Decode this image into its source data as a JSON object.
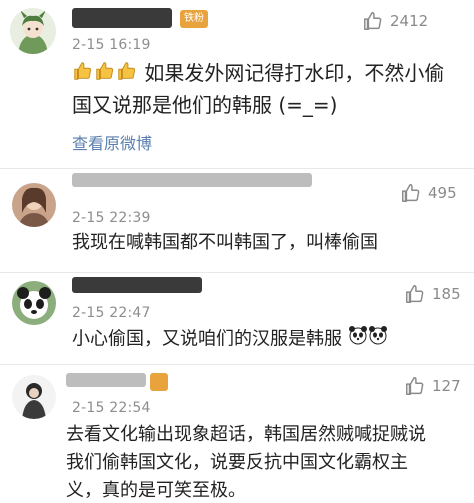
{
  "comments": [
    {
      "time": "2-15 16:19",
      "likes": "2412",
      "badge": "铁粉",
      "text_line1": "如果发外网记得打水印，不然小偷",
      "text_line2": "国又说那是他们的韩服 (=_=)",
      "view_original": "查看原微博",
      "thumb_emoji_icons": [
        "thumbs-up-icon",
        "thumbs-up-icon",
        "thumbs-up-icon"
      ]
    },
    {
      "time": "2-15 22:39",
      "likes": "495",
      "text": "我现在喊韩国都不叫韩国了，叫棒偷国"
    },
    {
      "time": "2-15 22:47",
      "likes": "185",
      "text": "小心偷国，又说咱们的汉服是韩服",
      "emoji_icons": [
        "panda-face-icon",
        "panda-face-icon"
      ]
    },
    {
      "time": "2-15 22:54",
      "likes": "127",
      "text_line1": "去看文化输出现象超话，韩国居然贼喊捉贼说",
      "text_line2": "我们偷韩国文化，说要反抗中国文化霸权主",
      "text_line3": "义，真的是可笑至极。"
    }
  ],
  "colors": {
    "link": "#5a7fae",
    "badge": "#e8a33c",
    "meta": "#8e8e8e"
  }
}
